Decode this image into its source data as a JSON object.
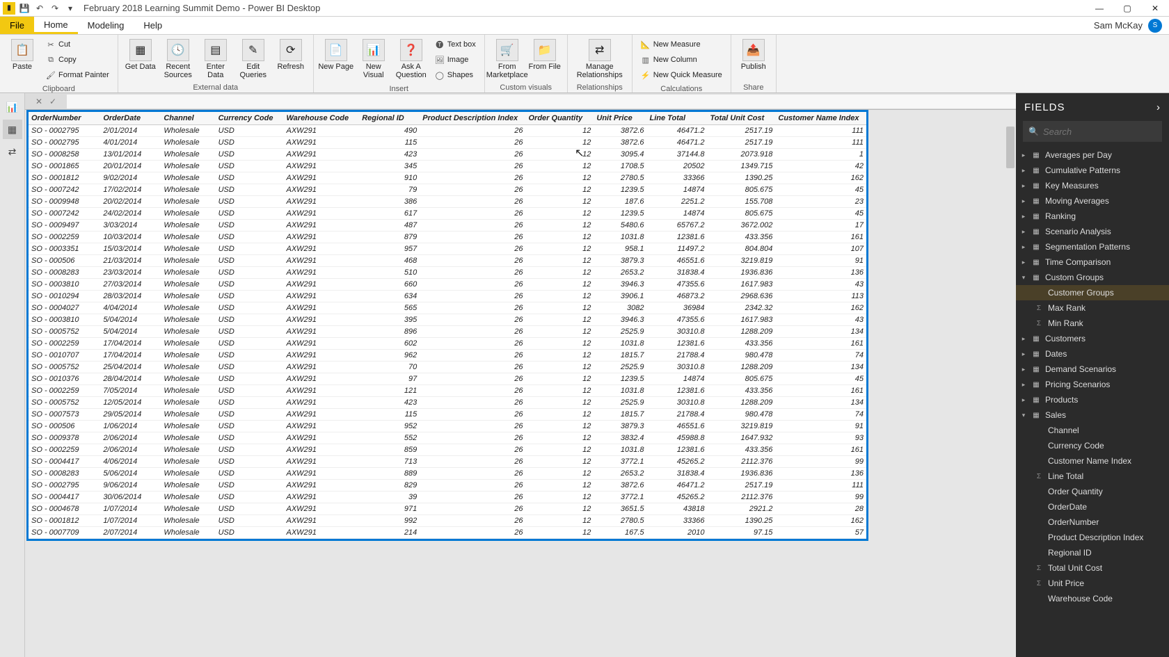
{
  "titlebar": {
    "title": "February 2018 Learning Summit Demo - Power BI Desktop"
  },
  "user": {
    "name": "Sam McKay"
  },
  "tabs": {
    "file": "File",
    "home": "Home",
    "modeling": "Modeling",
    "help": "Help"
  },
  "ribbon": {
    "clipboard": {
      "label": "Clipboard",
      "paste": "Paste",
      "cut": "Cut",
      "copy": "Copy",
      "format_painter": "Format Painter"
    },
    "external": {
      "label": "External data",
      "get_data": "Get Data",
      "recent_sources": "Recent Sources",
      "enter_data": "Enter Data",
      "edit_queries": "Edit Queries",
      "refresh": "Refresh"
    },
    "insert": {
      "label": "Insert",
      "new_page": "New Page",
      "new_visual": "New Visual",
      "ask_question": "Ask A Question",
      "text_box": "Text box",
      "image": "Image",
      "shapes": "Shapes"
    },
    "custom": {
      "label": "Custom visuals",
      "from_marketplace": "From Marketplace",
      "from_file": "From File"
    },
    "relationships": {
      "label": "Relationships",
      "manage": "Manage Relationships"
    },
    "calculations": {
      "label": "Calculations",
      "new_measure": "New Measure",
      "new_column": "New Column",
      "new_quick_measure": "New Quick Measure"
    },
    "share": {
      "label": "Share",
      "publish": "Publish"
    }
  },
  "fields_pane": {
    "title": "FIELDS",
    "search_placeholder": "Search",
    "tables": [
      {
        "name": "Averages per Day",
        "expanded": false
      },
      {
        "name": "Cumulative Patterns",
        "expanded": false
      },
      {
        "name": "Key Measures",
        "expanded": false
      },
      {
        "name": "Moving Averages",
        "expanded": false
      },
      {
        "name": "Ranking",
        "expanded": false
      },
      {
        "name": "Scenario Analysis",
        "expanded": false
      },
      {
        "name": "Segmentation Patterns",
        "expanded": false
      },
      {
        "name": "Time Comparison",
        "expanded": false
      },
      {
        "name": "Custom Groups",
        "expanded": true,
        "fields": [
          {
            "name": "Customer Groups",
            "icon": "",
            "selected": true
          },
          {
            "name": "Max Rank",
            "icon": "sigma"
          },
          {
            "name": "Min Rank",
            "icon": "sigma"
          }
        ]
      },
      {
        "name": "Customers",
        "expanded": false
      },
      {
        "name": "Dates",
        "expanded": false
      },
      {
        "name": "Demand Scenarios",
        "expanded": false
      },
      {
        "name": "Pricing Scenarios",
        "expanded": false
      },
      {
        "name": "Products",
        "expanded": false
      },
      {
        "name": "Sales",
        "expanded": true,
        "fields": [
          {
            "name": "Channel"
          },
          {
            "name": "Currency Code"
          },
          {
            "name": "Customer Name Index"
          },
          {
            "name": "Line Total",
            "icon": "sigma"
          },
          {
            "name": "Order Quantity"
          },
          {
            "name": "OrderDate"
          },
          {
            "name": "OrderNumber"
          },
          {
            "name": "Product Description Index"
          },
          {
            "name": "Regional ID"
          },
          {
            "name": "Total Unit Cost",
            "icon": "sigma"
          },
          {
            "name": "Unit Price",
            "icon": "sigma"
          },
          {
            "name": "Warehouse Code"
          }
        ]
      }
    ]
  },
  "table": {
    "columns": [
      "OrderNumber",
      "OrderDate",
      "Channel",
      "Currency Code",
      "Warehouse Code",
      "Regional ID",
      "Product Description Index",
      "Order Quantity",
      "Unit Price",
      "Line Total",
      "Total Unit Cost",
      "Customer Name Index"
    ],
    "rows": [
      [
        "SO - 0002795",
        "2/01/2014",
        "Wholesale",
        "USD",
        "AXW291",
        "490",
        "26",
        "12",
        "3872.6",
        "46471.2",
        "2517.19",
        "111"
      ],
      [
        "SO - 0002795",
        "4/01/2014",
        "Wholesale",
        "USD",
        "AXW291",
        "115",
        "26",
        "12",
        "3872.6",
        "46471.2",
        "2517.19",
        "111"
      ],
      [
        "SO - 0008258",
        "13/01/2014",
        "Wholesale",
        "USD",
        "AXW291",
        "423",
        "26",
        "12",
        "3095.4",
        "37144.8",
        "2073.918",
        "1"
      ],
      [
        "SO - 0001865",
        "20/01/2014",
        "Wholesale",
        "USD",
        "AXW291",
        "345",
        "26",
        "12",
        "1708.5",
        "20502",
        "1349.715",
        "42"
      ],
      [
        "SO - 0001812",
        "9/02/2014",
        "Wholesale",
        "USD",
        "AXW291",
        "910",
        "26",
        "12",
        "2780.5",
        "33366",
        "1390.25",
        "162"
      ],
      [
        "SO - 0007242",
        "17/02/2014",
        "Wholesale",
        "USD",
        "AXW291",
        "79",
        "26",
        "12",
        "1239.5",
        "14874",
        "805.675",
        "45"
      ],
      [
        "SO - 0009948",
        "20/02/2014",
        "Wholesale",
        "USD",
        "AXW291",
        "386",
        "26",
        "12",
        "187.6",
        "2251.2",
        "155.708",
        "23"
      ],
      [
        "SO - 0007242",
        "24/02/2014",
        "Wholesale",
        "USD",
        "AXW291",
        "617",
        "26",
        "12",
        "1239.5",
        "14874",
        "805.675",
        "45"
      ],
      [
        "SO - 0009497",
        "3/03/2014",
        "Wholesale",
        "USD",
        "AXW291",
        "487",
        "26",
        "12",
        "5480.6",
        "65767.2",
        "3672.002",
        "17"
      ],
      [
        "SO - 0002259",
        "10/03/2014",
        "Wholesale",
        "USD",
        "AXW291",
        "879",
        "26",
        "12",
        "1031.8",
        "12381.6",
        "433.356",
        "161"
      ],
      [
        "SO - 0003351",
        "15/03/2014",
        "Wholesale",
        "USD",
        "AXW291",
        "957",
        "26",
        "12",
        "958.1",
        "11497.2",
        "804.804",
        "107"
      ],
      [
        "SO - 000506",
        "21/03/2014",
        "Wholesale",
        "USD",
        "AXW291",
        "468",
        "26",
        "12",
        "3879.3",
        "46551.6",
        "3219.819",
        "91"
      ],
      [
        "SO - 0008283",
        "23/03/2014",
        "Wholesale",
        "USD",
        "AXW291",
        "510",
        "26",
        "12",
        "2653.2",
        "31838.4",
        "1936.836",
        "136"
      ],
      [
        "SO - 0003810",
        "27/03/2014",
        "Wholesale",
        "USD",
        "AXW291",
        "660",
        "26",
        "12",
        "3946.3",
        "47355.6",
        "1617.983",
        "43"
      ],
      [
        "SO - 0010294",
        "28/03/2014",
        "Wholesale",
        "USD",
        "AXW291",
        "634",
        "26",
        "12",
        "3906.1",
        "46873.2",
        "2968.636",
        "113"
      ],
      [
        "SO - 0004027",
        "4/04/2014",
        "Wholesale",
        "USD",
        "AXW291",
        "565",
        "26",
        "12",
        "3082",
        "36984",
        "2342.32",
        "162"
      ],
      [
        "SO - 0003810",
        "5/04/2014",
        "Wholesale",
        "USD",
        "AXW291",
        "395",
        "26",
        "12",
        "3946.3",
        "47355.6",
        "1617.983",
        "43"
      ],
      [
        "SO - 0005752",
        "5/04/2014",
        "Wholesale",
        "USD",
        "AXW291",
        "896",
        "26",
        "12",
        "2525.9",
        "30310.8",
        "1288.209",
        "134"
      ],
      [
        "SO - 0002259",
        "17/04/2014",
        "Wholesale",
        "USD",
        "AXW291",
        "602",
        "26",
        "12",
        "1031.8",
        "12381.6",
        "433.356",
        "161"
      ],
      [
        "SO - 0010707",
        "17/04/2014",
        "Wholesale",
        "USD",
        "AXW291",
        "962",
        "26",
        "12",
        "1815.7",
        "21788.4",
        "980.478",
        "74"
      ],
      [
        "SO - 0005752",
        "25/04/2014",
        "Wholesale",
        "USD",
        "AXW291",
        "70",
        "26",
        "12",
        "2525.9",
        "30310.8",
        "1288.209",
        "134"
      ],
      [
        "SO - 0010376",
        "28/04/2014",
        "Wholesale",
        "USD",
        "AXW291",
        "97",
        "26",
        "12",
        "1239.5",
        "14874",
        "805.675",
        "45"
      ],
      [
        "SO - 0002259",
        "7/05/2014",
        "Wholesale",
        "USD",
        "AXW291",
        "121",
        "26",
        "12",
        "1031.8",
        "12381.6",
        "433.356",
        "161"
      ],
      [
        "SO - 0005752",
        "12/05/2014",
        "Wholesale",
        "USD",
        "AXW291",
        "423",
        "26",
        "12",
        "2525.9",
        "30310.8",
        "1288.209",
        "134"
      ],
      [
        "SO - 0007573",
        "29/05/2014",
        "Wholesale",
        "USD",
        "AXW291",
        "115",
        "26",
        "12",
        "1815.7",
        "21788.4",
        "980.478",
        "74"
      ],
      [
        "SO - 000506",
        "1/06/2014",
        "Wholesale",
        "USD",
        "AXW291",
        "952",
        "26",
        "12",
        "3879.3",
        "46551.6",
        "3219.819",
        "91"
      ],
      [
        "SO - 0009378",
        "2/06/2014",
        "Wholesale",
        "USD",
        "AXW291",
        "552",
        "26",
        "12",
        "3832.4",
        "45988.8",
        "1647.932",
        "93"
      ],
      [
        "SO - 0002259",
        "2/06/2014",
        "Wholesale",
        "USD",
        "AXW291",
        "859",
        "26",
        "12",
        "1031.8",
        "12381.6",
        "433.356",
        "161"
      ],
      [
        "SO - 0004417",
        "4/06/2014",
        "Wholesale",
        "USD",
        "AXW291",
        "713",
        "26",
        "12",
        "3772.1",
        "45265.2",
        "2112.376",
        "99"
      ],
      [
        "SO - 0008283",
        "5/06/2014",
        "Wholesale",
        "USD",
        "AXW291",
        "889",
        "26",
        "12",
        "2653.2",
        "31838.4",
        "1936.836",
        "136"
      ],
      [
        "SO - 0002795",
        "9/06/2014",
        "Wholesale",
        "USD",
        "AXW291",
        "829",
        "26",
        "12",
        "3872.6",
        "46471.2",
        "2517.19",
        "111"
      ],
      [
        "SO - 0004417",
        "30/06/2014",
        "Wholesale",
        "USD",
        "AXW291",
        "39",
        "26",
        "12",
        "3772.1",
        "45265.2",
        "2112.376",
        "99"
      ],
      [
        "SO - 0004678",
        "1/07/2014",
        "Wholesale",
        "USD",
        "AXW291",
        "971",
        "26",
        "12",
        "3651.5",
        "43818",
        "2921.2",
        "28"
      ],
      [
        "SO - 0001812",
        "1/07/2014",
        "Wholesale",
        "USD",
        "AXW291",
        "992",
        "26",
        "12",
        "2780.5",
        "33366",
        "1390.25",
        "162"
      ],
      [
        "SO - 0007709",
        "2/07/2014",
        "Wholesale",
        "USD",
        "AXW291",
        "214",
        "26",
        "12",
        "167.5",
        "2010",
        "97.15",
        "57"
      ]
    ]
  }
}
